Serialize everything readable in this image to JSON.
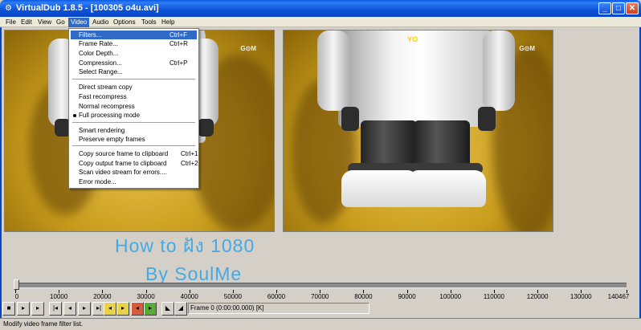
{
  "window": {
    "title": "VirtualDub 1.8.5 - [100305 o4u.avi]",
    "minimize": "_",
    "maximize": "□",
    "close": "✕"
  },
  "menubar": [
    "File",
    "Edit",
    "View",
    "Go",
    "Video",
    "Audio",
    "Options",
    "Tools",
    "Help"
  ],
  "video_menu": {
    "items": [
      {
        "label": "Filters...",
        "shortcut": "Ctrl+F"
      },
      {
        "label": "Frame Rate...",
        "shortcut": "Ctrl+R"
      },
      {
        "label": "Color Depth...",
        "shortcut": ""
      },
      {
        "label": "Compression...",
        "shortcut": "Ctrl+P"
      },
      {
        "label": "Select Range...",
        "shortcut": ""
      },
      {
        "label": "Direct stream copy",
        "shortcut": ""
      },
      {
        "label": "Fast recompress",
        "shortcut": ""
      },
      {
        "label": "Normal recompress",
        "shortcut": ""
      },
      {
        "label": "Full processing mode",
        "shortcut": ""
      },
      {
        "label": "Smart rendering",
        "shortcut": ""
      },
      {
        "label": "Preserve empty frames",
        "shortcut": ""
      },
      {
        "label": "Copy source frame to clipboard",
        "shortcut": "Ctrl+1"
      },
      {
        "label": "Copy output frame to clipboard",
        "shortcut": "Ctrl+2"
      },
      {
        "label": "Scan video stream for errors....",
        "shortcut": ""
      },
      {
        "label": "Error mode...",
        "shortcut": ""
      }
    ]
  },
  "panes": {
    "watermark": "G⊙M"
  },
  "overlay": {
    "line1": "How to ฝัง 1080",
    "line2": "By SoulMe"
  },
  "timeline": {
    "labels": [
      "0",
      "10000",
      "20000",
      "30000",
      "40000",
      "50000",
      "60000",
      "70000",
      "80000",
      "90000",
      "100000",
      "110000",
      "120000",
      "130000",
      "140467"
    ],
    "max": 140467,
    "position": 0
  },
  "frame_info": "Frame 0 (0:00:00.000) [K]",
  "status": "Modify video frame filter list.",
  "colors": {
    "titlebar": "#0a5ae6",
    "highlight": "#316ac5",
    "overlay_text": "#44a9e6"
  }
}
